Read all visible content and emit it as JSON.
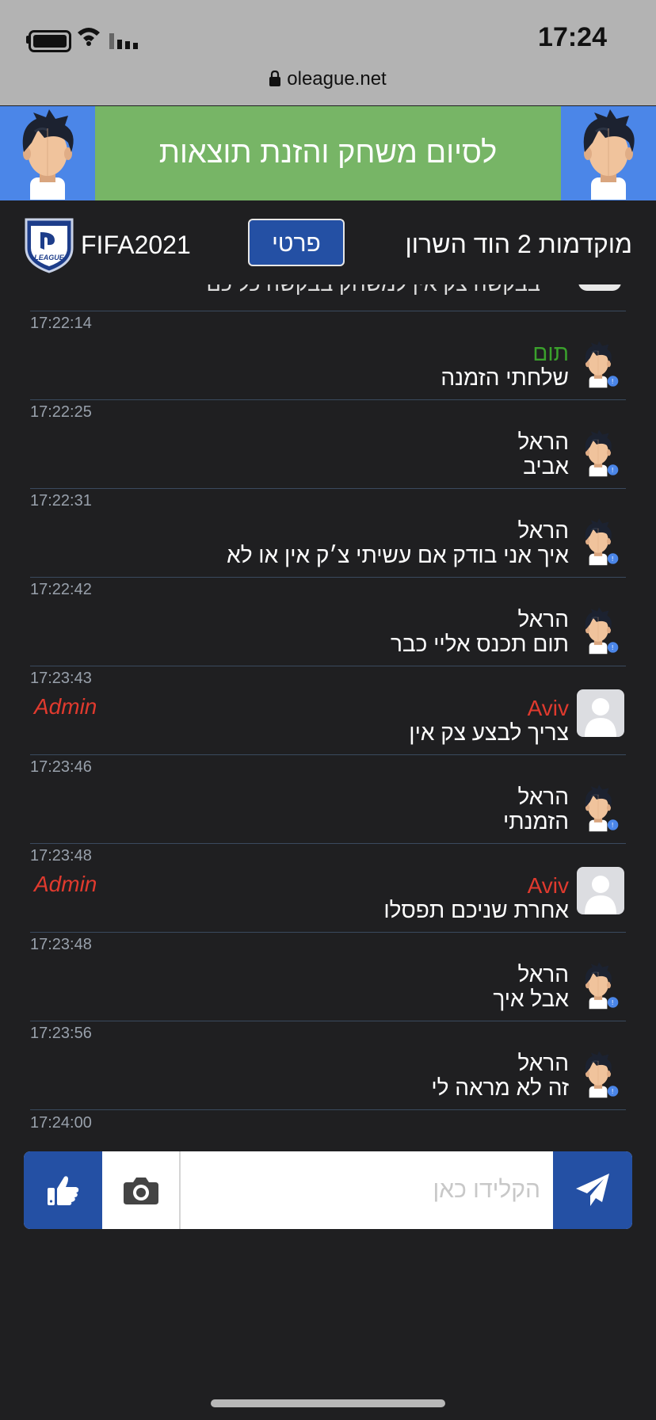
{
  "status_bar": {
    "time": "17:24",
    "url": "oleague.net"
  },
  "banner": {
    "text": "לסיום משחק והזנת תוצאות",
    "colors": {
      "background": "#77b566",
      "side": "#4b86e8"
    }
  },
  "header": {
    "game": "FIFA2021",
    "private_button": "פרטי",
    "league_title": "מוקדמות 2 הוד השרון",
    "logo_text": "LEAGUE"
  },
  "chat": {
    "partial_text": "בבקשה צק אין למשחק בבקשה כל כם",
    "messages": [
      {
        "time": "17:22:14",
        "name": "תום",
        "text": "שלחתי הזמנה",
        "name_color": "green",
        "admin": false
      },
      {
        "time": "17:22:25",
        "name": "הראל",
        "text": "אביב",
        "name_color": "white",
        "admin": false
      },
      {
        "time": "17:22:31",
        "name": "הראל",
        "text": "איך אני בודק אם עשיתי צ׳ק אין או לא",
        "name_color": "white",
        "admin": false
      },
      {
        "time": "17:22:42",
        "name": "הראל",
        "text": "תום תכנס אליי כבר",
        "name_color": "white",
        "admin": false
      },
      {
        "time": "17:23:43",
        "name": "Aviv",
        "text": "צריך לבצע צק אין",
        "name_color": "red",
        "admin": true,
        "admin_label": "Admin"
      },
      {
        "time": "17:23:46",
        "name": "הראל",
        "text": "הזמנתי",
        "name_color": "white",
        "admin": false
      },
      {
        "time": "17:23:48",
        "name": "Aviv",
        "text": "אחרת שניכם תפסלו",
        "name_color": "red",
        "admin": true,
        "admin_label": "Admin"
      },
      {
        "time": "17:23:48",
        "name": "הראל",
        "text": "אבל איך",
        "name_color": "white",
        "admin": false
      },
      {
        "time": "17:23:56",
        "name": "הראל",
        "text": "זה לא מראה לי",
        "name_color": "white",
        "admin": false
      }
    ],
    "last_time": "17:24:00"
  },
  "input_bar": {
    "placeholder": "הקלידו כאן",
    "value": "",
    "icons": {
      "like": "thumbs-up-icon",
      "camera": "camera-icon",
      "send": "paper-plane-icon"
    }
  },
  "colors": {
    "accent": "#2450a4",
    "background": "#1f1f21",
    "admin": "#e03a2e",
    "green_name": "#3aa12c"
  }
}
